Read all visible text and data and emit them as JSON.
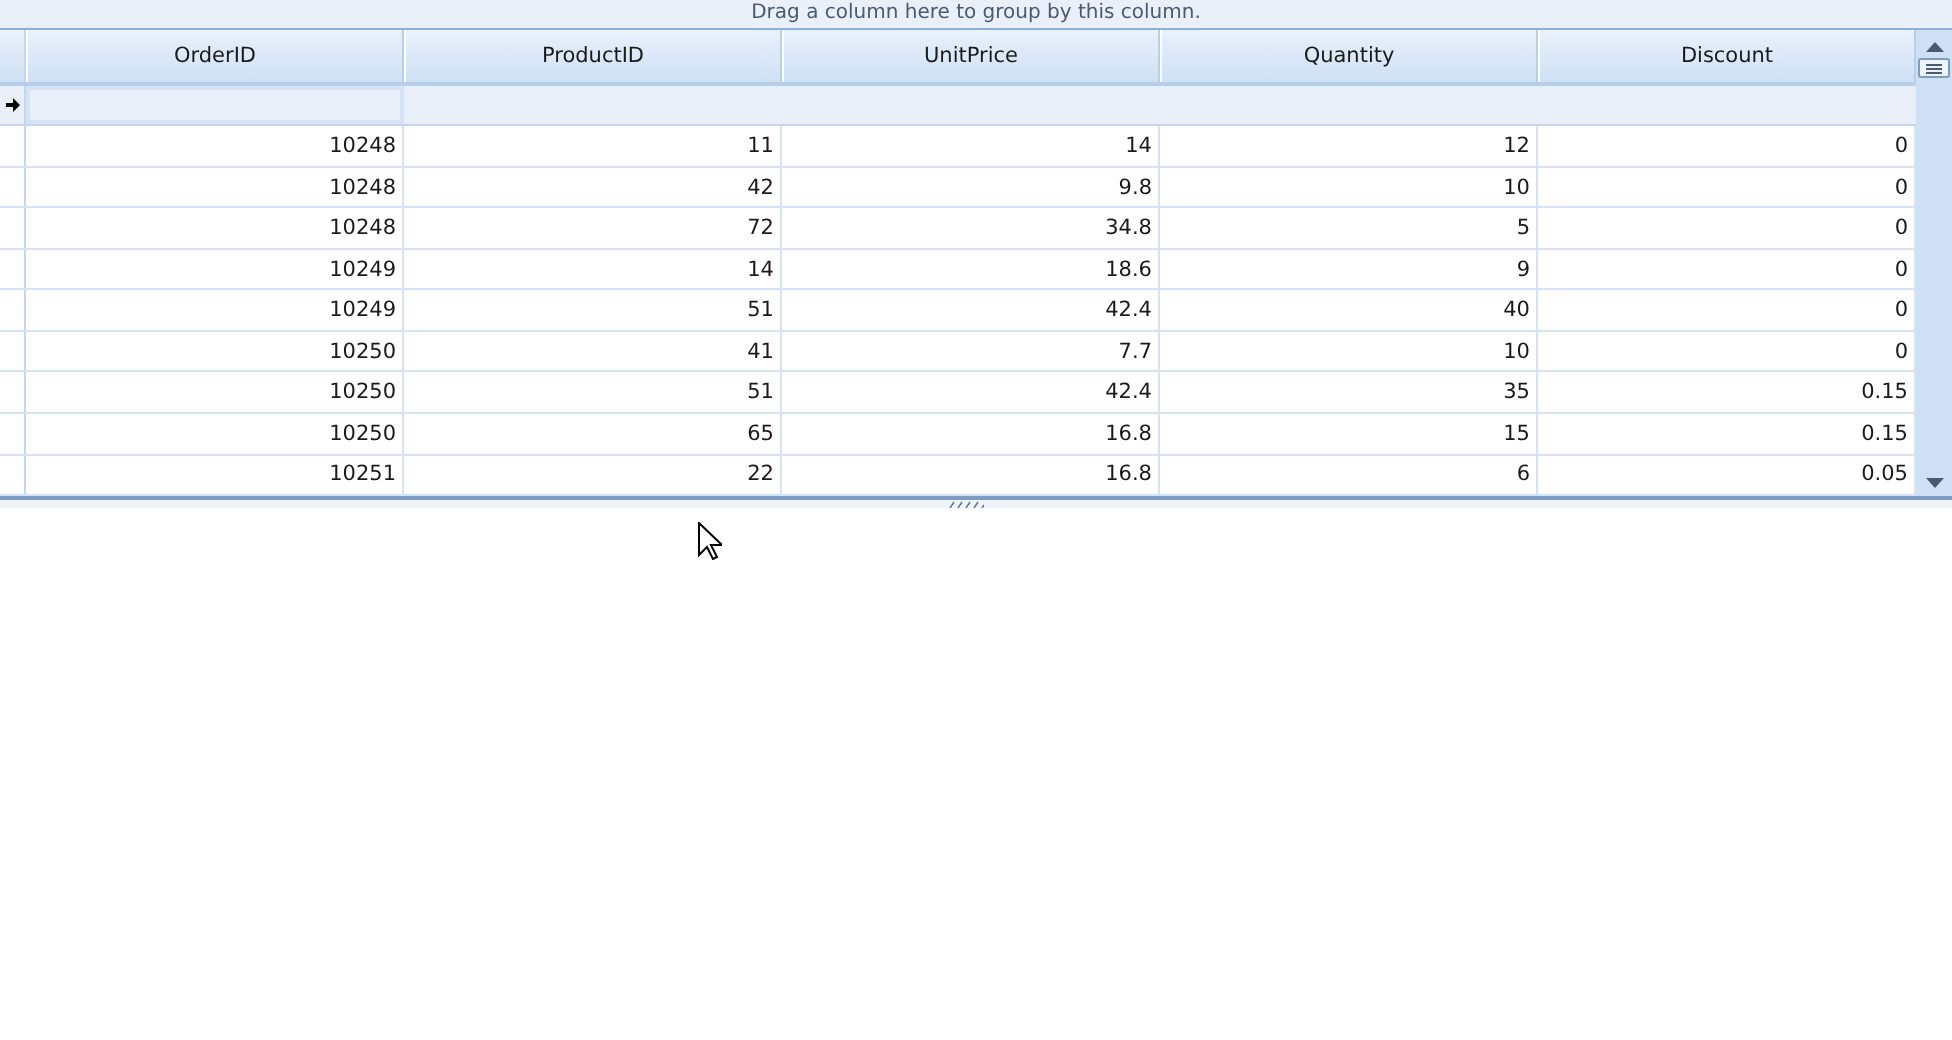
{
  "group_panel": {
    "text": "Drag a column here to group by this column."
  },
  "columns": [
    "OrderID",
    "ProductID",
    "UnitPrice",
    "Quantity",
    "Discount"
  ],
  "rows": [
    [
      "10248",
      "11",
      "14",
      "12",
      "0"
    ],
    [
      "10248",
      "42",
      "9.8",
      "10",
      "0"
    ],
    [
      "10248",
      "72",
      "34.8",
      "5",
      "0"
    ],
    [
      "10249",
      "14",
      "18.6",
      "9",
      "0"
    ],
    [
      "10249",
      "51",
      "42.4",
      "40",
      "0"
    ],
    [
      "10250",
      "41",
      "7.7",
      "10",
      "0"
    ],
    [
      "10250",
      "51",
      "42.4",
      "35",
      "0.15"
    ],
    [
      "10250",
      "65",
      "16.8",
      "15",
      "0.15"
    ],
    [
      "10251",
      "22",
      "16.8",
      "6",
      "0.05"
    ]
  ]
}
